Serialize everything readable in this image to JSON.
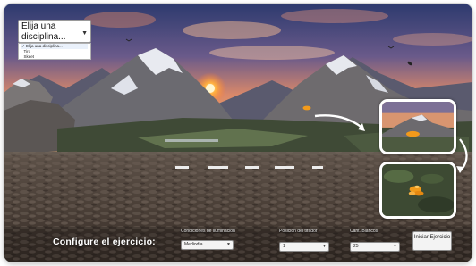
{
  "discipline": {
    "selected_label": "Elija una disciplina...",
    "options": [
      "Elija una disciplina...",
      "Tiro",
      "Skeet"
    ]
  },
  "config": {
    "title": "Configure el ejercicio:",
    "lighting": {
      "label": "Condiciones de iluminación",
      "value": "Mediodía"
    },
    "position": {
      "label": "Posición del tirador",
      "value": "1"
    },
    "targets": {
      "label": "Cant. Blancos",
      "value": "25"
    },
    "start_button": "Iniciar Ejercicio"
  },
  "colors": {
    "target_orange": "#f29a1a",
    "highlight_border": "#ffffff",
    "sky_top": "#2d3a6e",
    "sky_horizon": "#f08a3a"
  }
}
